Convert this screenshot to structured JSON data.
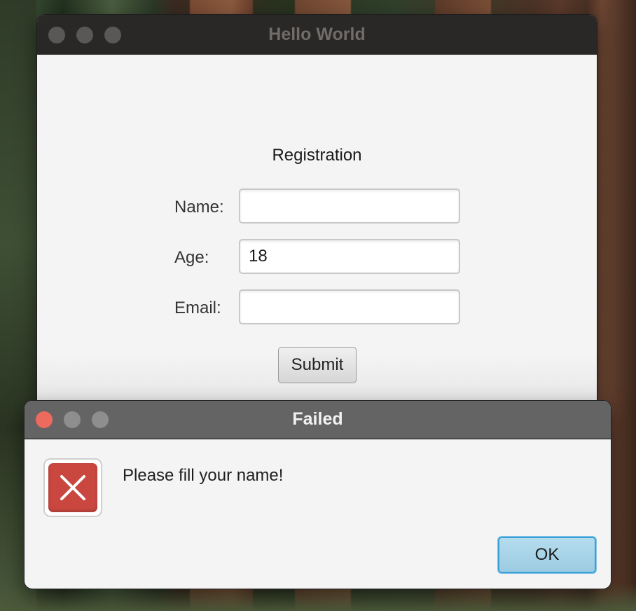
{
  "main_window": {
    "title": "Hello World",
    "form": {
      "heading": "Registration",
      "name_label": "Name:",
      "name_value": "",
      "age_label": "Age:",
      "age_value": "18",
      "email_label": "Email:",
      "email_value": "",
      "submit_label": "Submit"
    }
  },
  "dialog": {
    "title": "Failed",
    "message": "Please fill your name!",
    "ok_label": "OK",
    "icon": "error-x-icon"
  },
  "colors": {
    "titlebar_dark": "#2a2826",
    "dialog_titlebar": "#646464",
    "close_red": "#ec6a5e",
    "error_red": "#c9473f",
    "ok_blue": "#9ccbe2"
  }
}
